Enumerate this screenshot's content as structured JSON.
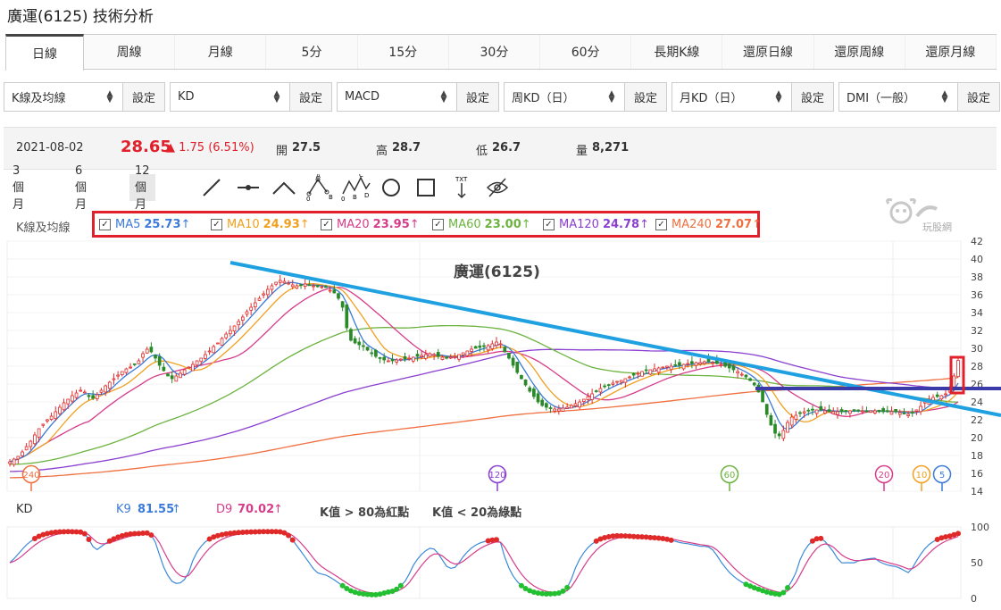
{
  "title": "廣運(6125) 技術分析",
  "tabs": [
    "日線",
    "周線",
    "月線",
    "5分",
    "15分",
    "30分",
    "60分",
    "長期K線",
    "還原日線",
    "還原周線",
    "還原月線"
  ],
  "active_tab": "日線",
  "selectors": [
    {
      "value": "K線及均線",
      "button": "設定"
    },
    {
      "value": "KD",
      "button": "設定"
    },
    {
      "value": "MACD",
      "button": "設定"
    },
    {
      "value": "周KD（日）",
      "button": "設定"
    },
    {
      "value": "月KD（日）",
      "button": "設定"
    },
    {
      "value": "DMI（一般）",
      "button": "設定"
    }
  ],
  "quote": {
    "date": "2021-08-02",
    "price": "28.65",
    "change": "▲ 1.75 (6.51%)",
    "open_label": "開",
    "open": "27.5",
    "high_label": "高",
    "high": "28.7",
    "low_label": "低",
    "low": "26.7",
    "vol_label": "量",
    "vol": "8,271"
  },
  "ranges": [
    "3 個月",
    "6 個月",
    "12 個月"
  ],
  "active_range": "12 個月",
  "ma_section_label": "K線及均線",
  "ma_items": [
    {
      "name": "MA5",
      "value": "25.73",
      "arrow": "↑",
      "color": "#3b7ad8"
    },
    {
      "name": "MA10",
      "value": "24.93",
      "arrow": "↑",
      "color": "#f0a020"
    },
    {
      "name": "MA20",
      "value": "23.95",
      "arrow": "↑",
      "color": "#d63c8a"
    },
    {
      "name": "MA60",
      "value": "23.00",
      "arrow": "↑",
      "color": "#6cb33f"
    },
    {
      "name": "MA120",
      "value": "24.78",
      "arrow": "↑",
      "color": "#8a3fd0"
    },
    {
      "name": "MA240",
      "value": "27.07",
      "arrow": "↑",
      "color": "#f07040"
    }
  ],
  "logo_text": "玩股網",
  "kd": {
    "label": "KD",
    "k_label": "K9",
    "k_value": "81.55",
    "k_arrow": "↑",
    "k_color": "#3b7ad8",
    "d_label": "D9",
    "d_value": "70.02",
    "d_arrow": "↑",
    "d_color": "#d63c8a",
    "note_red": "K值 > 80為紅點",
    "note_green": "K值 < 20為綠點"
  },
  "chart_data": {
    "type": "candlestick",
    "title": "廣運(6125)",
    "y_ticks": [
      14,
      16,
      18,
      20,
      22,
      24,
      26,
      28,
      30,
      32,
      34,
      36,
      38,
      40,
      42
    ],
    "ylim": [
      14,
      42
    ],
    "close": [
      17.3,
      17.6,
      17.9,
      18.4,
      19.0,
      19.6,
      20.3,
      21.0,
      21.5,
      22.0,
      22.4,
      22.9,
      23.4,
      23.9,
      24.3,
      24.7,
      25.0,
      25.3,
      25.1,
      24.6,
      24.4,
      24.8,
      25.3,
      25.8,
      26.2,
      26.6,
      27.0,
      27.4,
      27.7,
      27.9,
      28.2,
      28.6,
      29.4,
      29.9,
      29.6,
      28.9,
      28.1,
      27.5,
      26.9,
      26.6,
      26.9,
      27.2,
      27.6,
      27.9,
      28.2,
      28.6,
      28.9,
      29.3,
      29.7,
      30.2,
      30.6,
      31.1,
      31.6,
      32.0,
      32.5,
      33.0,
      33.5,
      34.1,
      34.6,
      35.1,
      35.6,
      36.1,
      36.6,
      37.0,
      37.4,
      37.6,
      37.5,
      37.3,
      37.1,
      37.0,
      37.1,
      37.2,
      37.1,
      37.0,
      36.9,
      36.9,
      36.8,
      36.5,
      36.2,
      35.6,
      34.6,
      32.3,
      30.9,
      30.6,
      30.4,
      30.2,
      29.8,
      29.4,
      29.1,
      28.9,
      28.7,
      28.6,
      28.6,
      28.7,
      28.8,
      28.8,
      28.9,
      29.0,
      29.1,
      29.2,
      29.3,
      29.4,
      29.3,
      29.1,
      29.0,
      28.9,
      29.0,
      29.1,
      29.3,
      29.5,
      29.7,
      29.9,
      30.0,
      30.1,
      30.2,
      30.3,
      30.5,
      30.7,
      30.5,
      29.6,
      28.9,
      28.1,
      27.3,
      26.6,
      25.9,
      25.2,
      24.6,
      24.0,
      23.6,
      23.4,
      23.3,
      23.2,
      23.2,
      23.3,
      23.4,
      23.6,
      23.8,
      24.0,
      24.3,
      24.6,
      24.9,
      25.2,
      25.5,
      25.7,
      25.9,
      26.1,
      26.3,
      26.4,
      26.6,
      26.8,
      27.0,
      27.2,
      27.4,
      27.5,
      27.6,
      27.7,
      27.8,
      27.9,
      28.0,
      28.0,
      28.1,
      28.1,
      28.2,
      28.3,
      28.3,
      28.4,
      28.4,
      28.5,
      28.5,
      28.4,
      28.3,
      28.2,
      28.0,
      27.8,
      27.6,
      27.4,
      27.1,
      26.8,
      26.4,
      25.9,
      25.1,
      24.0,
      22.6,
      21.4,
      20.5,
      20.2,
      20.8,
      21.7,
      22.3,
      22.5,
      22.7,
      22.9,
      23.0,
      23.1,
      23.1,
      23.1,
      23.0,
      22.9,
      22.9,
      22.9,
      22.9,
      23.0,
      23.0,
      23.0,
      23.0,
      23.0,
      23.0,
      23.0,
      23.0,
      22.9,
      22.9,
      22.9,
      22.9,
      22.9,
      22.8,
      22.7,
      22.6,
      22.8,
      23.1,
      23.5,
      24.0,
      24.3,
      24.5,
      24.6,
      24.7,
      24.9,
      25.4,
      26.9,
      28.65
    ],
    "ma_series": [
      "MA5",
      "MA10",
      "MA20",
      "MA60",
      "MA120",
      "MA240"
    ],
    "markers": [
      "240",
      "120",
      "60",
      "20",
      "10",
      "5"
    ],
    "kd": {
      "y_ticks": [
        0,
        50,
        100
      ],
      "ylim": [
        0,
        100
      ]
    }
  }
}
